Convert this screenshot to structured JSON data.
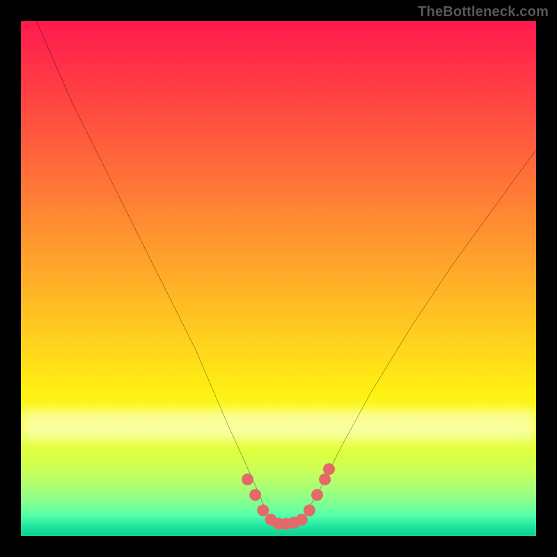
{
  "attribution": "TheBottleneck.com",
  "chart_data": {
    "type": "line",
    "title": "",
    "xlabel": "",
    "ylabel": "",
    "xlim": [
      0,
      100
    ],
    "ylim": [
      0,
      100
    ],
    "series": [
      {
        "name": "bottleneck-curve",
        "x": [
          3,
          10,
          18,
          26,
          34,
          40,
          45,
          48,
          50,
          52,
          55,
          58,
          62,
          68,
          76,
          84,
          92,
          100
        ],
        "y": [
          100,
          84,
          68,
          52,
          36,
          22,
          11,
          4,
          2,
          2,
          4,
          9,
          17,
          28,
          41,
          53,
          64,
          75
        ]
      }
    ],
    "markers": {
      "name": "flat-region-markers",
      "color": "#e46a6a",
      "points": [
        {
          "x": 44,
          "y": 11
        },
        {
          "x": 45.5,
          "y": 8
        },
        {
          "x": 47,
          "y": 5
        },
        {
          "x": 48.5,
          "y": 3.2
        },
        {
          "x": 50,
          "y": 2.4
        },
        {
          "x": 51.5,
          "y": 2.4
        },
        {
          "x": 53,
          "y": 2.6
        },
        {
          "x": 54.5,
          "y": 3.2
        },
        {
          "x": 56,
          "y": 5
        },
        {
          "x": 57.5,
          "y": 8
        },
        {
          "x": 59,
          "y": 11
        },
        {
          "x": 59.8,
          "y": 13
        }
      ]
    },
    "background": {
      "type": "vertical-gradient",
      "top_color": "#ff1a4d",
      "mid_color": "#fff012",
      "bottom_color": "#10cc90"
    }
  }
}
